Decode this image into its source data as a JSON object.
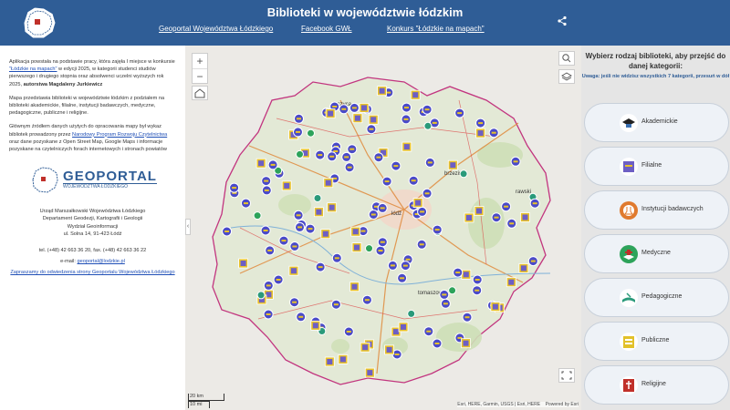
{
  "header": {
    "title": "Biblioteki w województwie łódzkim",
    "links": [
      "Geoportal Województwa Łódzkiego",
      "Facebook GWŁ",
      "Konkurs \"Łódzkie na mapach\""
    ]
  },
  "left": {
    "p1_a": "Aplikacja powstała na podstawie pracy, która zajęła I miejsce w konkursie ",
    "p1_link": "\"Łódzkie na mapach\"",
    "p1_b": " w edycji 2025, w kategorii studenci studiów pierwszego i drugiego stopnia oraz absolwenci uczelni wyższych rok 2025, ",
    "p1_bold": "autorstwa Magdaleny Jurkiewicz",
    "p2": "Mapa przedstawia biblioteki w województwie łódzkim z podziałem na biblioteki akademickie, filialne, instytucji badawczych, medyczne, pedagogiczne, publiczne i religijne.",
    "p3_a": "Głównym źródłem danych użytych do opracowania mapy był wykaz bibliotek prowadzony przez ",
    "p3_link": "Narodowy Program Rozwoju Czytelnictwa",
    "p3_b": " oraz dane pozyskane z Open Street Map, Google Maps i informacje pozyskane na czytelniczych forach internetowych i stronach powiatów",
    "logo_big": "GEOPORTAL",
    "logo_small": "WOJEWÓDZTWA ŁÓDZKIEGO",
    "address": [
      "Urząd Marszałkowski Województwa Łódzkiego",
      "Departament Geodezji, Kartografii i Geologii",
      "Wydział Geoinformacji",
      "ul. Solna 14, 91-423 Łódź"
    ],
    "phone": "tel. (+48) 42 663 36 20, fax. (+48) 42 663 36 22",
    "email_label": "e-mail: ",
    "email": "geoportal@lodzkie.pl",
    "invite": "Zapraszamy do odwiedzenia strony Geoportalu Województwa Łódzkiego"
  },
  "map": {
    "scale_km": "20 km",
    "scale_mi": "10 mi",
    "attribution": "Esri, HERE, Garmin, USGS | Esri, HERE",
    "powered": "Powered by Esri",
    "zoom_in": "+",
    "zoom_out": "−",
    "collapse": "‹",
    "place_labels": [
      "brzeziny",
      "rawski",
      "łódź",
      "tomaszowski",
      "łęczyca"
    ]
  },
  "right": {
    "heading": "Wybierz rodzaj biblioteki, aby przejść do danej kategorii:",
    "note": "Uwaga: jeśli nie widzisz wszystkich 7 kategorii, przesuń w dół",
    "categories": [
      {
        "label": "Akademickie",
        "color": "#3a6fb0"
      },
      {
        "label": "Filialne",
        "color": "#6d5fc4"
      },
      {
        "label": "Instytucji badawczych",
        "color": "#e07a2e"
      },
      {
        "label": "Medyczne",
        "color": "#2da35a"
      },
      {
        "label": "Pedagogiczne",
        "color": "#2a9a7a"
      },
      {
        "label": "Publiczne",
        "color": "#e2c12a"
      },
      {
        "label": "Religijne",
        "color": "#c0302a"
      }
    ]
  },
  "colors": {
    "header": "#2f5d96",
    "border": "#c2357f",
    "filialne": "#4a4ac8",
    "publiczne": "#e8c22a"
  }
}
